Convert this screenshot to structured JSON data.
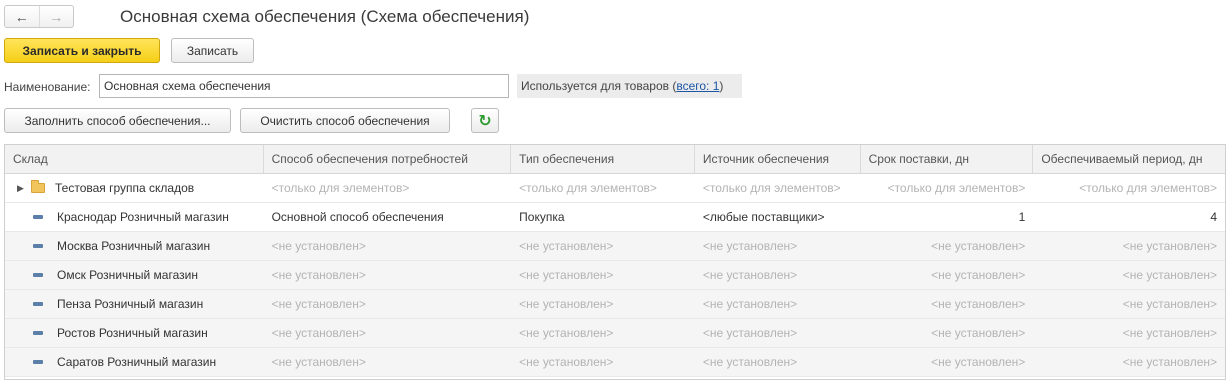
{
  "window": {
    "title": "Основная схема обеспечения (Схема обеспечения)"
  },
  "nav": {
    "back_icon": "arrow-left-icon",
    "forward_icon": "arrow-right-icon"
  },
  "toolbar": {
    "save_close_label": "Записать и закрыть",
    "save_label": "Записать"
  },
  "form": {
    "name_label": "Наименование:",
    "name_value": "Основная схема обеспечения",
    "usage_text": "Используется для товаров (",
    "usage_link": "всего: 1",
    "usage_close": ")"
  },
  "actions": {
    "fill_label": "Заполнить способ обеспечения...",
    "clear_label": "Очистить способ обеспечения",
    "refresh_icon": "refresh-icon"
  },
  "colors": {
    "primary_button": "#f5cf17",
    "refresh_icon": "#2e9b2e",
    "link": "#1c55a5"
  },
  "table": {
    "columns": [
      "Склад",
      "Способ обеспечения потребностей",
      "Тип обеспечения",
      "Источник обеспечения",
      "Срок поставки, дн",
      "Обеспечиваемый период, дн"
    ],
    "rows": [
      {
        "name": "Тестовая группа складов",
        "method": "<только для элементов>",
        "type": "<только для элементов>",
        "source": "<только для элементов>",
        "lead": "<только для элементов>",
        "period": "<только для элементов>"
      },
      {
        "name": "Краснодар Розничный магазин",
        "method": "Основной способ обеспечения",
        "type": "Покупка",
        "source": "<любые поставщики>",
        "lead": "1",
        "period": "4"
      },
      {
        "name": "Москва Розничный магазин",
        "method": "<не установлен>",
        "type": "<не установлен>",
        "source": "<не установлен>",
        "lead": "<не установлен>",
        "period": "<не установлен>"
      },
      {
        "name": "Омск Розничный магазин",
        "method": "<не установлен>",
        "type": "<не установлен>",
        "source": "<не установлен>",
        "lead": "<не установлен>",
        "period": "<не установлен>"
      },
      {
        "name": "Пенза Розничный магазин",
        "method": "<не установлен>",
        "type": "<не установлен>",
        "source": "<не установлен>",
        "lead": "<не установлен>",
        "period": "<не установлен>"
      },
      {
        "name": "Ростов Розничный магазин",
        "method": "<не установлен>",
        "type": "<не установлен>",
        "source": "<не установлен>",
        "lead": "<не установлен>",
        "period": "<не установлен>"
      },
      {
        "name": "Саратов Розничный магазин",
        "method": "<не установлен>",
        "type": "<не установлен>",
        "source": "<не установлен>",
        "lead": "<не установлен>",
        "period": "<не установлен>"
      }
    ]
  }
}
